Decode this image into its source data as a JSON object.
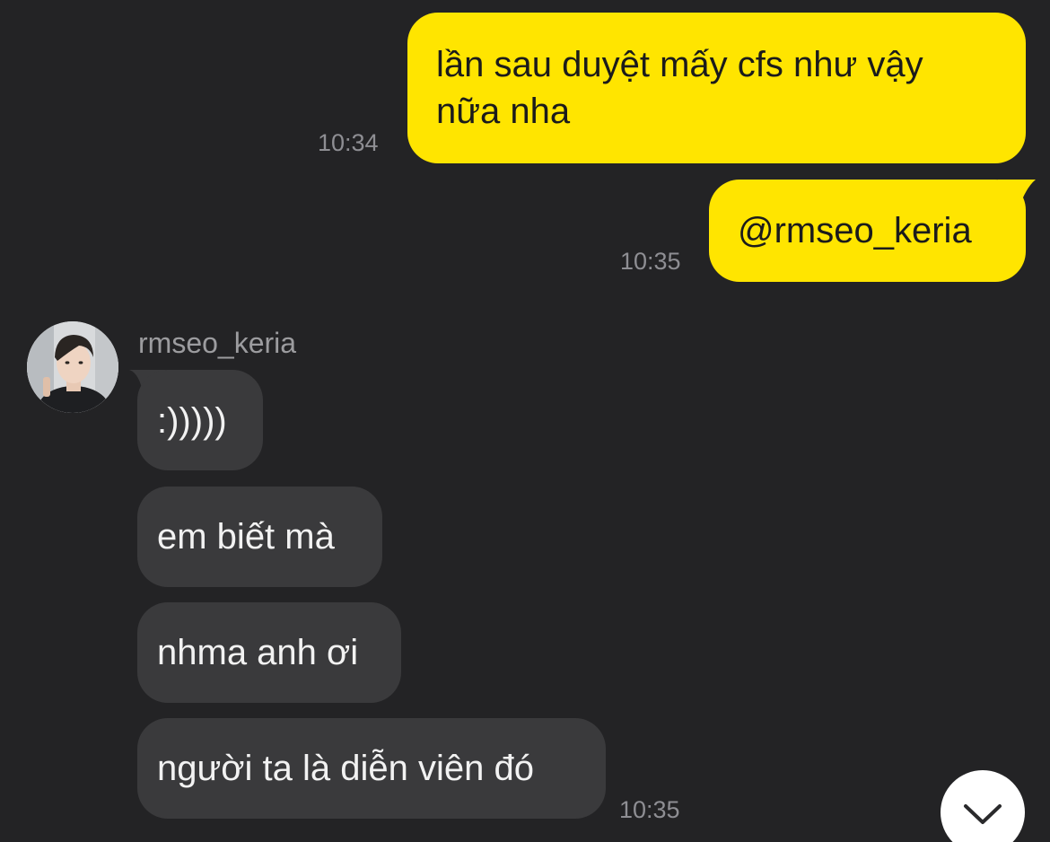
{
  "messages": {
    "outgoing": [
      {
        "text": "lần sau duyệt mấy cfs như vậy nữa nha",
        "time": "10:34"
      },
      {
        "text": "@rmseo_keria",
        "time": "10:35"
      }
    ],
    "incoming": {
      "sender": "rmseo_keria",
      "avatar_icon": "profile-photo",
      "items": [
        {
          "text": ":)))))"
        },
        {
          "text": "em biết mà"
        },
        {
          "text": "nhma anh ơi"
        },
        {
          "text": "người ta là diễn viên đó"
        }
      ],
      "time": "10:35"
    }
  },
  "scroll_button": {
    "icon": "chevron-down-icon"
  },
  "colors": {
    "background": "#232325",
    "outgoing_bubble": "#ffe500",
    "incoming_bubble": "#3a3a3c",
    "timestamp": "#8e8e93"
  }
}
